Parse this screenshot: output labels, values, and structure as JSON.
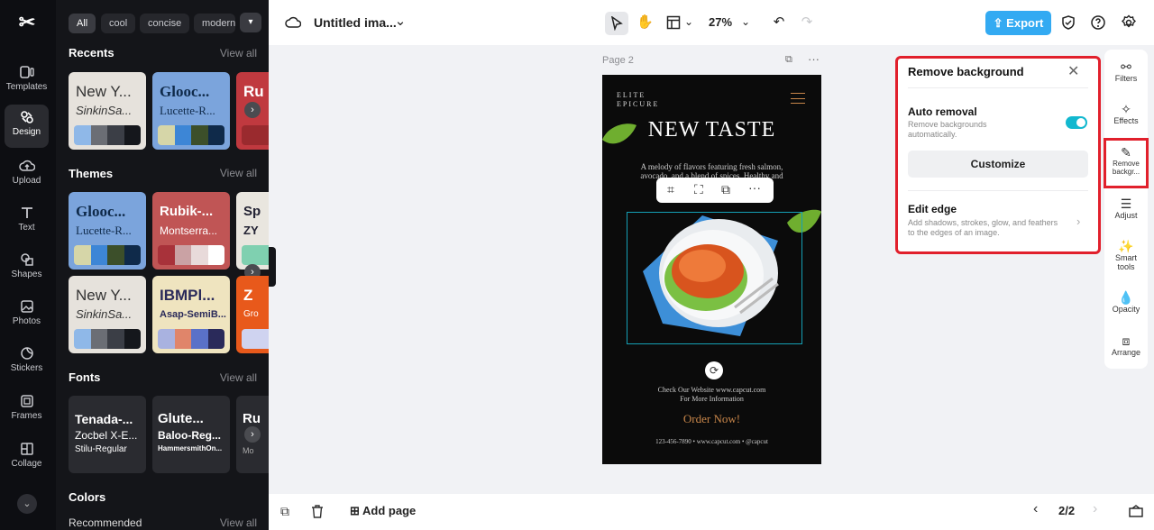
{
  "left_rail": {
    "items": [
      {
        "label": "Templates"
      },
      {
        "label": "Design"
      },
      {
        "label": "Upload"
      },
      {
        "label": "Text"
      },
      {
        "label": "Shapes"
      },
      {
        "label": "Photos"
      },
      {
        "label": "Stickers"
      },
      {
        "label": "Frames"
      },
      {
        "label": "Collage"
      }
    ]
  },
  "panel": {
    "chips": [
      "All",
      "cool",
      "concise",
      "modern"
    ],
    "view_all": "View all",
    "recents": {
      "title": "Recents",
      "cards": [
        {
          "t1": "New Y...",
          "t2": "SinkinSa...",
          "bg": "#e6e2dc",
          "fg": "#333"
        },
        {
          "t1": "Glooc...",
          "t2": "Lucette-R...",
          "bg": "#7ba4dc",
          "fg": "#0f2a4a"
        },
        {
          "t1": "Ru",
          "t2": "",
          "bg": "#c0393f",
          "fg": "#fff"
        }
      ]
    },
    "themes": {
      "title": "Themes",
      "cards": [
        {
          "t1": "Glooc...",
          "t2": "Lucette-R...",
          "bg": "#7ba4dc",
          "fg": "#0f2a4a"
        },
        {
          "t1": "Rubik-...",
          "t2": "Montserra...",
          "bg": "#c05555",
          "fg": "#fff"
        },
        {
          "t1": "Sp",
          "t2": "ZY",
          "bg": "#e9e6df",
          "fg": "#223"
        },
        {
          "t1": "New Y...",
          "t2": "SinkinSa...",
          "bg": "#e6e2dc",
          "fg": "#333"
        },
        {
          "t1": "IBMPl...",
          "t2": "Asap-SemiB...",
          "bg": "#efe4bf",
          "fg": "#2a2a5a"
        },
        {
          "t1": "Z",
          "t2": "Gro",
          "bg": "#e8591b",
          "fg": "#fff"
        }
      ]
    },
    "fonts": {
      "title": "Fonts",
      "cards": [
        {
          "t1": "Tenada-...",
          "t2": "Zocbel X-E...",
          "t3": "Stilu-Regular"
        },
        {
          "t1": "Glute...",
          "t2": "Baloo-Reg...",
          "t3": "HammersmithOn..."
        },
        {
          "t1": "Ru",
          "t2": "",
          "t3": "Mo"
        }
      ]
    },
    "colors": {
      "title": "Colors",
      "recommended": "Recommended"
    }
  },
  "topbar": {
    "doc_title": "Untitled ima...",
    "zoom": "27%",
    "export_label": "Export"
  },
  "canvas": {
    "page_label": "Page 2",
    "poster": {
      "brand": "ELITE\nEPICURE",
      "headline": "NEW TASTE",
      "desc": "A melody of flavors featuring fresh salmon, avocado, and a blend of spices. Healthy and delicious",
      "website": "Check Our Website www.capcut.com\nFor More Information",
      "cta": "Order Now!",
      "footer": "123-456-7890 • www.capcut.com • @capcut"
    }
  },
  "remove_bg": {
    "title": "Remove background",
    "auto_title": "Auto removal",
    "auto_desc": "Remove backgrounds automatically.",
    "customize": "Customize",
    "edge_title": "Edit edge",
    "edge_desc": "Add shadows, strokes, glow, and feathers to the edges of an image.",
    "toggle_on": true
  },
  "right_tools": [
    {
      "label": "Filters"
    },
    {
      "label": "Effects"
    },
    {
      "label": "Remove backgr..."
    },
    {
      "label": "Adjust"
    },
    {
      "label": "Smart tools"
    },
    {
      "label": "Opacity"
    },
    {
      "label": "Arrange"
    }
  ],
  "bottombar": {
    "add_page": "Add page",
    "page_counter": "2/2"
  },
  "colors": {
    "accent": "#33aaf2",
    "highlight": "#e1202c",
    "toggle": "#12b8cf"
  }
}
